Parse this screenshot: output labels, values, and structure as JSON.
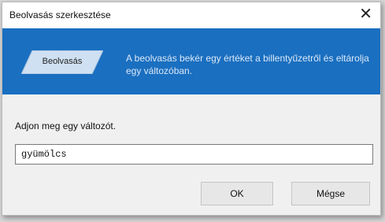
{
  "dialog": {
    "title": "Beolvasás szerkesztése",
    "close_glyph": "✕",
    "close_icon": "close-icon"
  },
  "banner": {
    "statement_label": "Beolvasás",
    "description": "A beolvasás bekér egy értéket a billentyűzetről és eltárolja egy változóban.",
    "background_color": "#1a6fc0",
    "statement_block_color": "#cfe0f2"
  },
  "form": {
    "prompt": "Adjon meg egy változót.",
    "value": "gyümölcs"
  },
  "buttons": {
    "ok_label": "OK",
    "cancel_label": "Mégse"
  }
}
